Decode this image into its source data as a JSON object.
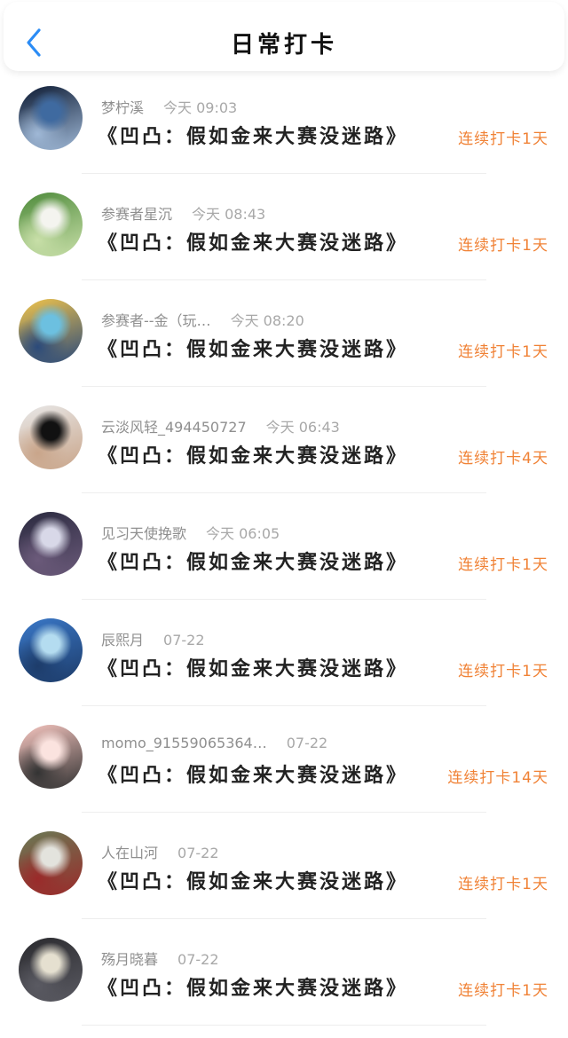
{
  "header": {
    "title": "日常打卡",
    "back_icon": "chevron-left-icon",
    "accent_color": "#2b8cf5"
  },
  "colors": {
    "streak": "#f08236",
    "meta": "#9a9a9a",
    "text": "#222222"
  },
  "checkins": [
    {
      "username": "梦柠溪",
      "time": "今天 09:03",
      "text": "《凹凸：假如金来大赛没迷路》",
      "streak": "连续打卡1天",
      "avatar_icon": "avatar-dark-blue-mage",
      "avatar_colors": [
        "#0c1a33",
        "#3f6aa0",
        "#9fb8d6"
      ]
    },
    {
      "username": "参赛者星沉",
      "time": "今天 08:43",
      "text": "《凹凸：假如金来大赛没迷路》",
      "streak": "连续打卡1天",
      "avatar_icon": "avatar-white-lily",
      "avatar_colors": [
        "#4d8a3a",
        "#f4f4ef",
        "#c8dfa8"
      ]
    },
    {
      "username": "参赛者--金（玩…",
      "time": "今天 08:20",
      "text": "《凹凸：假如金来大赛没迷路》",
      "streak": "连续打卡1天",
      "avatar_icon": "avatar-yellow-haired-character",
      "avatar_colors": [
        "#f2c54b",
        "#6cc0e0",
        "#2b4a7a"
      ]
    },
    {
      "username": "云淡风轻_494450727",
      "time": "今天 06:43",
      "text": "《凹凸：假如金来大赛没迷路》",
      "streak": "连续打卡4天",
      "avatar_icon": "avatar-dancer-black-dress",
      "avatar_colors": [
        "#e8e8e8",
        "#111111",
        "#c9a58a"
      ]
    },
    {
      "username": "见习天使挽歌",
      "time": "今天 06:05",
      "text": "《凹凸：假如金来大赛没迷路》",
      "streak": "连续打卡1天",
      "avatar_icon": "avatar-two-characters",
      "avatar_colors": [
        "#2a2a3f",
        "#d8d8e8",
        "#6b5a7a"
      ]
    },
    {
      "username": "辰熙月",
      "time": "07-22",
      "text": "《凹凸：假如金来大赛没迷路》",
      "streak": "连续打卡1天",
      "avatar_icon": "avatar-blue-sky-scene",
      "avatar_colors": [
        "#3a78c8",
        "#b4dcf0",
        "#1d3c6a"
      ]
    },
    {
      "username": "momo_91559065364…",
      "time": "07-22",
      "text": "《凹凸：假如金来大赛没迷路》",
      "streak": "连续打卡14天",
      "avatar_icon": "avatar-pink-blob",
      "avatar_colors": [
        "#f7c6c0",
        "#fbe3df",
        "#333333"
      ]
    },
    {
      "username": "人在山河",
      "time": "07-22",
      "text": "《凹凸：假如金来大赛没迷路》",
      "streak": "连续打卡1天",
      "avatar_icon": "avatar-group-characters",
      "avatar_colors": [
        "#6a7a55",
        "#e3e3dd",
        "#9a2a2a"
      ]
    },
    {
      "username": "殇月晓暮",
      "time": "07-22",
      "text": "《凹凸：假如金来大赛没迷路》",
      "streak": "连续打卡1天",
      "avatar_icon": "avatar-white-haired-dark",
      "avatar_colors": [
        "#2a2a2e",
        "#e5e0d0",
        "#5a5a62"
      ]
    }
  ]
}
